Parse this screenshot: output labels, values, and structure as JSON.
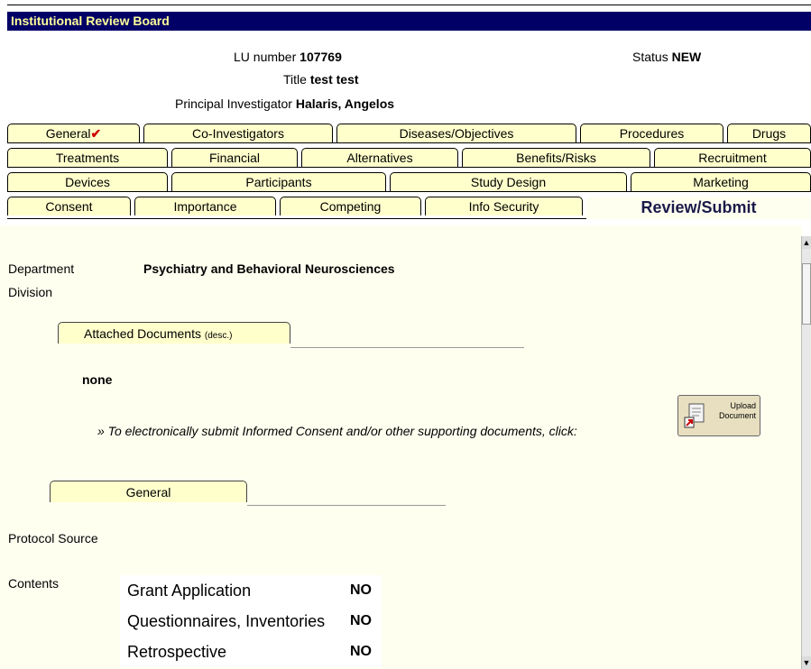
{
  "app": {
    "title": "Institutional Review Board"
  },
  "header": {
    "lu_label": "LU number",
    "lu_value": "107769",
    "title_label": "Title",
    "title_value": "test test",
    "pi_label": "Principal Investigator",
    "pi_value": "Halaris, Angelos",
    "status_label": "Status",
    "status_value": "NEW"
  },
  "tabs": {
    "row1": [
      "General",
      "Co-Investigators",
      "Diseases/Objectives",
      "Procedures",
      "Drugs"
    ],
    "row2": [
      "Treatments",
      "Financial",
      "Alternatives",
      "Benefits/Risks",
      "Recruitment"
    ],
    "row3": [
      "Devices",
      "Participants",
      "Study Design",
      "Marketing"
    ],
    "row4": [
      "Consent",
      "Importance",
      "Competing",
      "Info Security",
      "Review/Submit"
    ],
    "check_mark": "✔"
  },
  "details": {
    "department_label": "Department",
    "department_value": "Psychiatry and Behavioral Neurosciences",
    "division_label": "Division"
  },
  "attachments": {
    "tab_label": "Attached Documents",
    "tab_suffix": "(desc.)",
    "value": "none",
    "note": "» To electronically submit Informed Consent and/or other supporting documents, click:",
    "upload_line1": "Upload",
    "upload_line2": "Document"
  },
  "general_section": {
    "tab_label": "General",
    "protocol_source_label": "Protocol Source",
    "contents_label": "Contents",
    "contents": [
      {
        "name": "Grant Application",
        "value": "NO"
      },
      {
        "name": "Questionnaires, Inventories",
        "value": "NO"
      },
      {
        "name": "Retrospective",
        "value": "NO"
      }
    ]
  }
}
